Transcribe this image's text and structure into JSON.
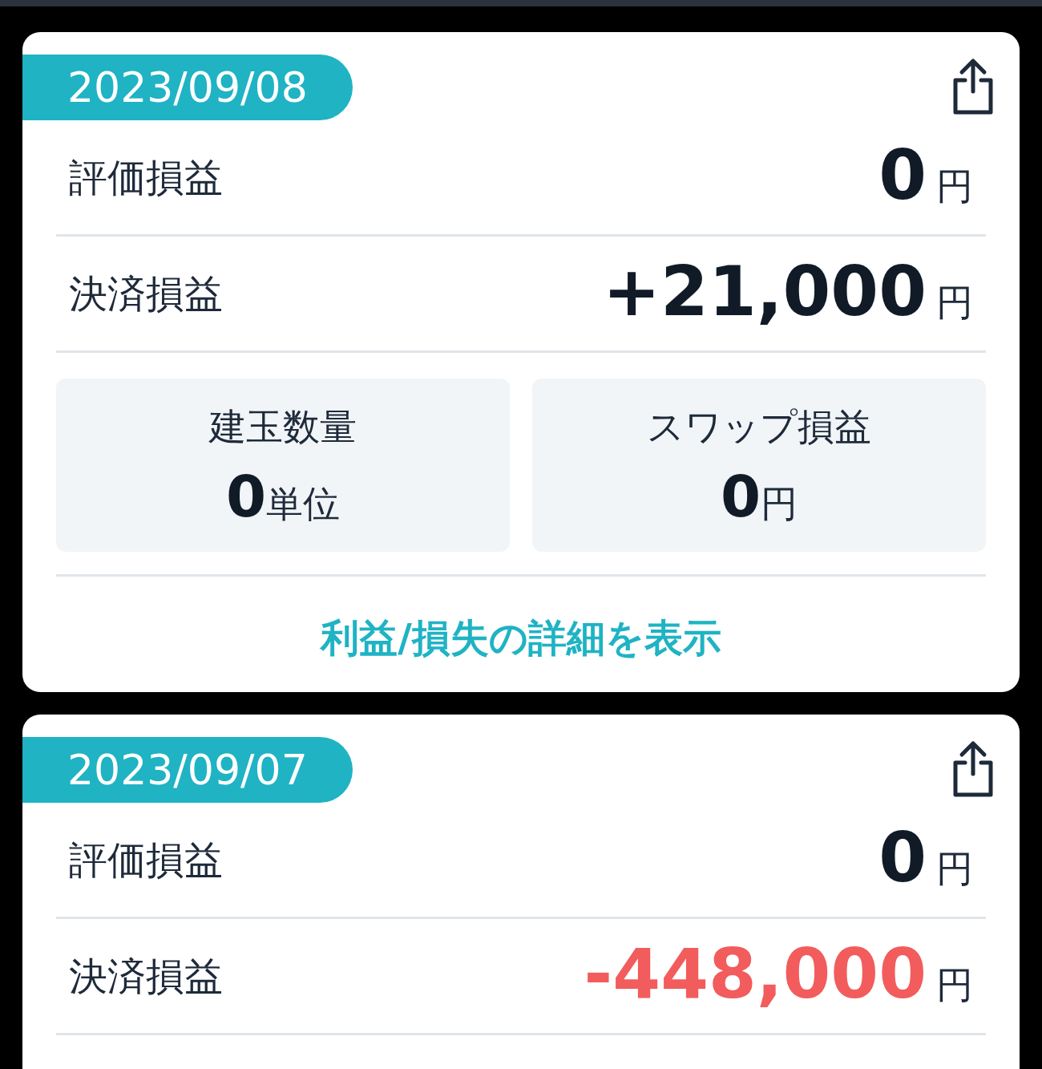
{
  "cards": [
    {
      "date": "2023/09/08",
      "rows": [
        {
          "label": "評価損益",
          "value": "0",
          "unit": "円",
          "negative": false
        },
        {
          "label": "決済損益",
          "value": "+21,000",
          "unit": "円",
          "negative": false
        }
      ],
      "boxes": [
        {
          "label": "建玉数量",
          "value": "0",
          "unit": "単位"
        },
        {
          "label": "スワップ損益",
          "value": "0",
          "unit": "円"
        }
      ],
      "link": "利益/損失の詳細を表示"
    },
    {
      "date": "2023/09/07",
      "rows": [
        {
          "label": "評価損益",
          "value": "0",
          "unit": "円",
          "negative": false
        },
        {
          "label": "決済損益",
          "value": "-448,000",
          "unit": "円",
          "negative": true
        }
      ]
    }
  ]
}
